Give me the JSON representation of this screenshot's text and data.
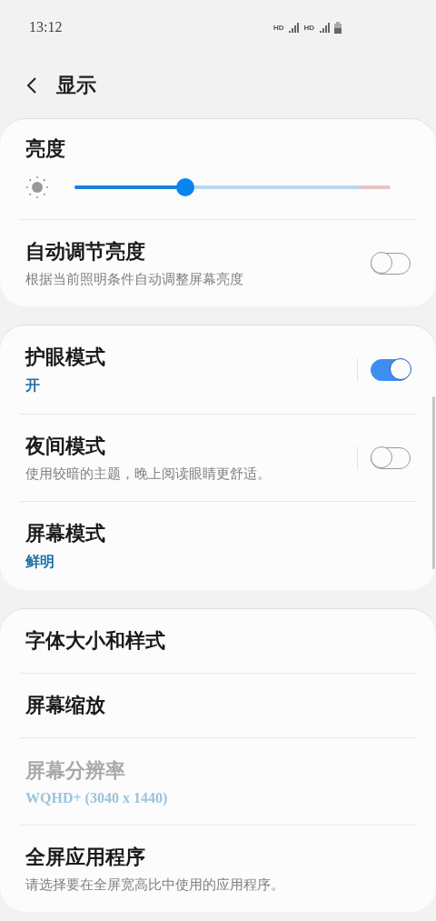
{
  "status_bar": {
    "time": "13:12",
    "indicators": [
      "HD",
      "HD"
    ]
  },
  "header": {
    "title": "显示"
  },
  "cards": [
    {
      "items": [
        {
          "kind": "slider",
          "title": "亮度",
          "level": 0.35
        },
        {
          "kind": "toggle",
          "title": "自动调节亮度",
          "description": "根据当前照明条件自动调整屏幕亮度",
          "on": false,
          "separator": false
        }
      ]
    },
    {
      "items": [
        {
          "kind": "toggle",
          "title": "护眼模式",
          "summary": "开",
          "on": true,
          "separator": true
        },
        {
          "kind": "toggle",
          "title": "夜间模式",
          "description": "使用较暗的主题，晚上阅读眼睛更舒适。",
          "on": false,
          "separator": true
        },
        {
          "kind": "plain",
          "title": "屏幕模式",
          "summary": "鲜明",
          "disabled": false
        }
      ]
    },
    {
      "items": [
        {
          "kind": "plain",
          "title": "字体大小和样式",
          "disabled": false
        },
        {
          "kind": "plain",
          "title": "屏幕缩放",
          "disabled": false
        },
        {
          "kind": "plain",
          "title": "屏幕分辨率",
          "summary": "WQHD+ (3040 x 1440)",
          "disabled": true
        },
        {
          "kind": "plain",
          "title": "全屏应用程序",
          "description": "请选择要在全屏宽高比中使用的应用程序。",
          "disabled": false
        }
      ]
    }
  ]
}
